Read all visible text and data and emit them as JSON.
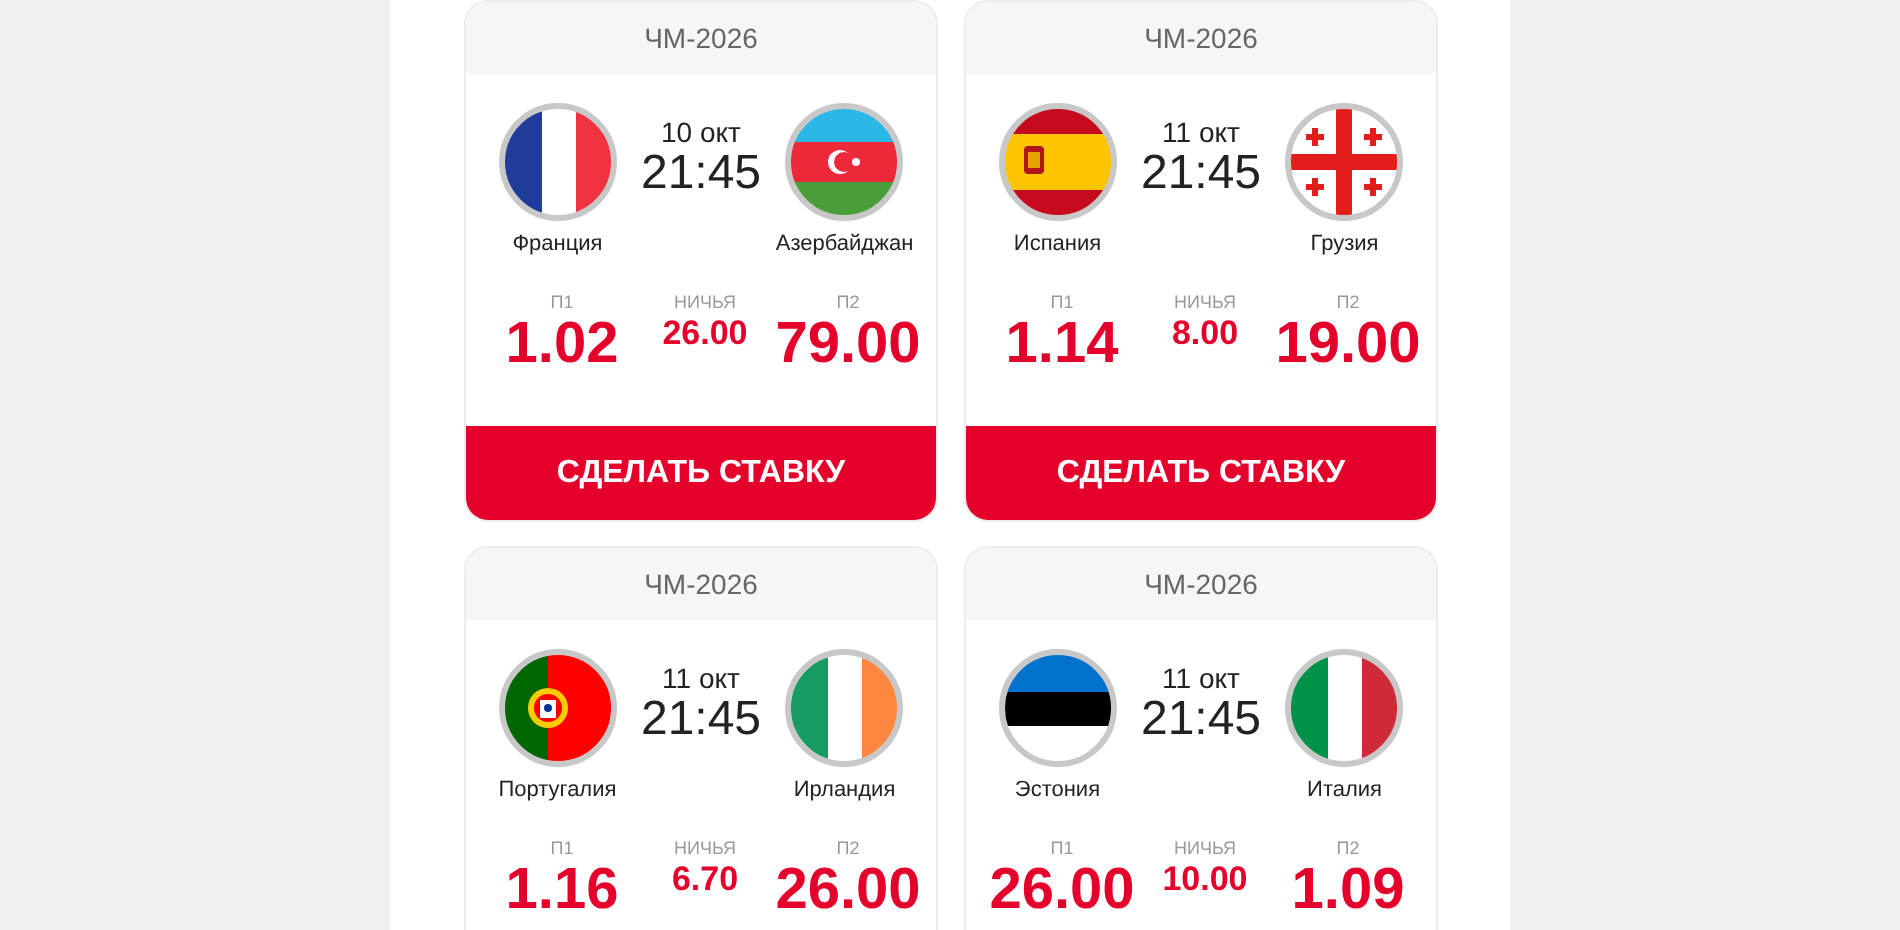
{
  "matches": [
    {
      "league": "ЧМ-2026",
      "date": "10 окт",
      "time": "21:45",
      "home": "Франция",
      "away": "Азербайджан",
      "odds": [
        {
          "label": "П1",
          "value": "1.02"
        },
        {
          "label": "НИЧЬЯ",
          "value": "26.00"
        },
        {
          "label": "П2",
          "value": "79.00"
        }
      ],
      "button": "СДЕЛАТЬ СТАВКУ"
    },
    {
      "league": "ЧМ-2026",
      "date": "11 окт",
      "time": "21:45",
      "home": "Испания",
      "away": "Грузия",
      "odds": [
        {
          "label": "П1",
          "value": "1.14"
        },
        {
          "label": "НИЧЬЯ",
          "value": "8.00"
        },
        {
          "label": "П2",
          "value": "19.00"
        }
      ],
      "button": "СДЕЛАТЬ СТАВКУ"
    },
    {
      "league": "ЧМ-2026",
      "date": "11 окт",
      "time": "21:45",
      "home": "Португалия",
      "away": "Ирландия",
      "odds": [
        {
          "label": "П1",
          "value": "1.16"
        },
        {
          "label": "НИЧЬЯ",
          "value": "6.70"
        },
        {
          "label": "П2",
          "value": "26.00"
        }
      ]
    },
    {
      "league": "ЧМ-2026",
      "date": "11 окт",
      "time": "21:45",
      "home": "Эстония",
      "away": "Италия",
      "odds": [
        {
          "label": "П1",
          "value": "26.00"
        },
        {
          "label": "НИЧЬЯ",
          "value": "10.00"
        },
        {
          "label": "П2",
          "value": "1.09"
        }
      ]
    }
  ]
}
